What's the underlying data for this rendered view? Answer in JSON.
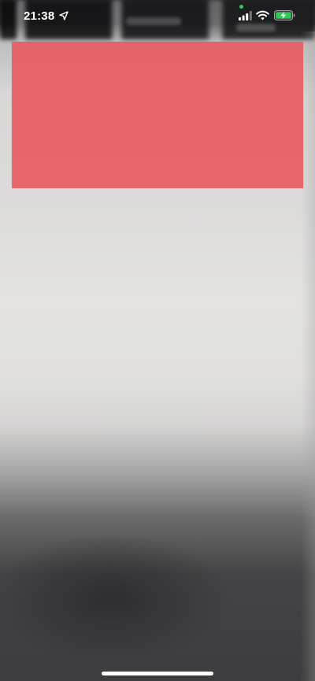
{
  "status_bar": {
    "time": "21:38",
    "location_icon": "location-arrow-icon",
    "signal_icon": "cellular-signal-icon",
    "wifi_icon": "wifi-icon",
    "battery_icon": "battery-charging-icon",
    "privacy_indicator_color": "#34c759",
    "battery_color": "#34c759"
  },
  "overlay": {
    "color": "#e8585d"
  },
  "home_indicator": {
    "icon": "home-indicator"
  }
}
